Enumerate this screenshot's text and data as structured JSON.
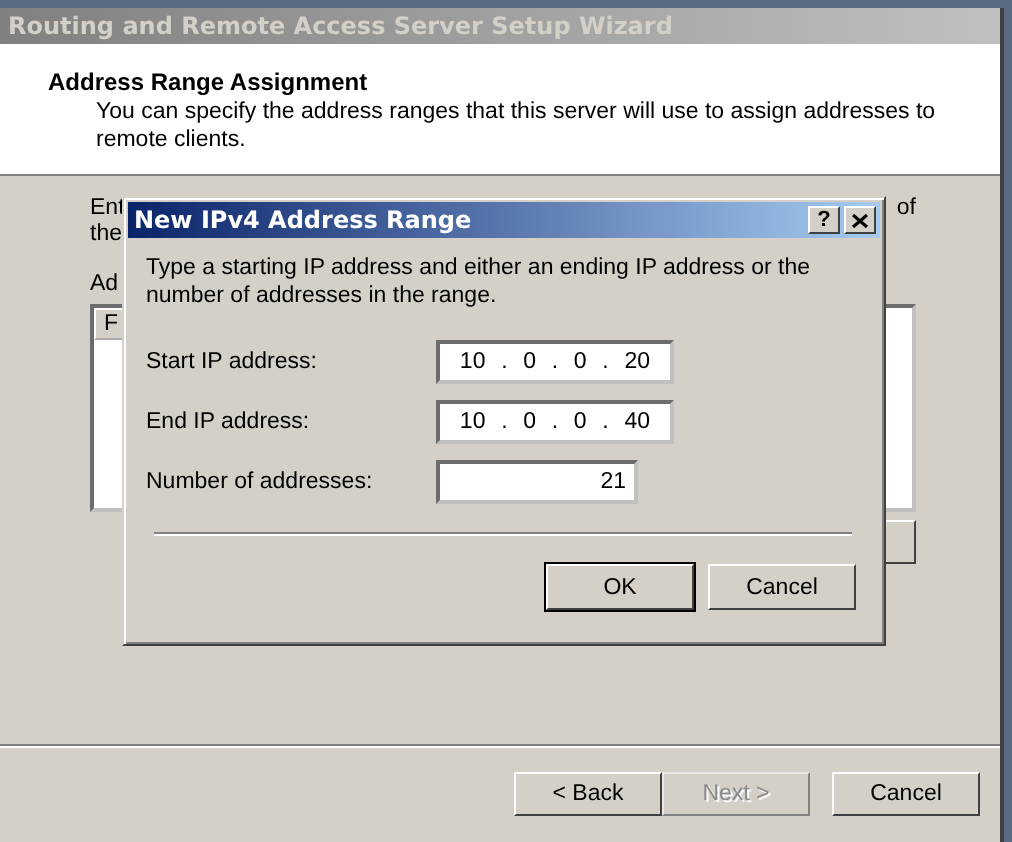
{
  "wizard": {
    "title": "Routing and Remote Access Server Setup Wizard",
    "active": false,
    "header": {
      "title": "Address Range Assignment",
      "subtitle": "You can specify the address ranges that this server will use to assign addresses to remote clients."
    },
    "fragments": {
      "line_1_start": "Ent",
      "line_1_end": "of",
      "line_2_start": "the",
      "list_label": "Ad",
      "list_column_1": "F"
    },
    "buttons": [
      {
        "label": "< Back",
        "disabled": false
      },
      {
        "label": "Next >",
        "disabled": true
      },
      {
        "label": "Cancel",
        "disabled": false
      }
    ]
  },
  "dialog": {
    "title": "New IPv4 Address Range",
    "help": "?",
    "intro": "Type a starting IP address and either an ending IP address or the number of addresses in the range.",
    "fields": [
      {
        "label": "Start IP address:",
        "kind": "ip",
        "segments": [
          "10",
          ".",
          "0",
          ".",
          "0",
          ".",
          "20"
        ]
      },
      {
        "label": "End IP address:",
        "kind": "ip",
        "segments": [
          "10",
          ".",
          "0",
          ".",
          "0",
          ".",
          "40"
        ]
      },
      {
        "label": "Number of addresses:",
        "kind": "number",
        "value": "21"
      }
    ],
    "buttons": [
      {
        "label": "OK",
        "default": true
      },
      {
        "label": "Cancel",
        "default": false
      }
    ]
  }
}
